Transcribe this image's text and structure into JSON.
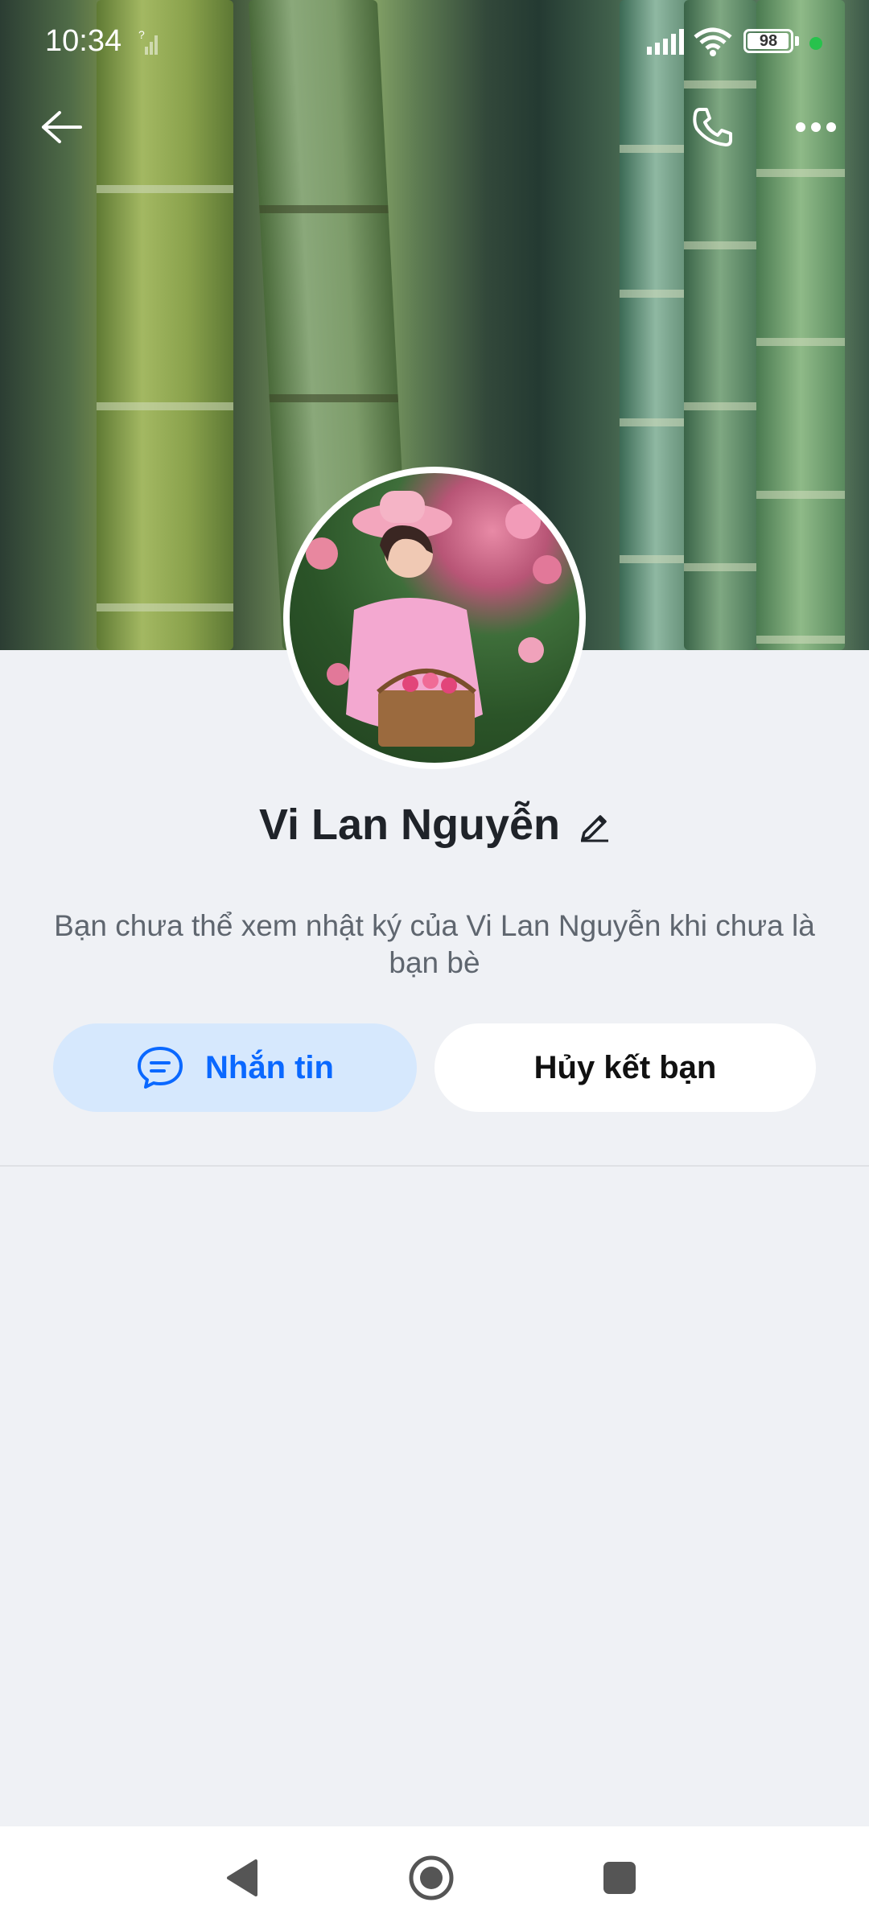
{
  "status_bar": {
    "time": "10:34",
    "battery_level": "98",
    "battery_fraction": 0.98,
    "notification_dot_color": "#27c24c",
    "icons": [
      "no-sim-icon",
      "cellular-signal-icon",
      "wifi-icon",
      "battery-icon"
    ]
  },
  "header": {
    "back_icon": "back-arrow-icon",
    "call_icon": "phone-icon",
    "more_icon": "more-options-icon"
  },
  "profile": {
    "name": "Vi Lan Nguyễn",
    "edit_icon": "pencil-icon",
    "notice": "Bạn chưa thể xem nhật ký của Vi Lan Nguyễn khi chưa là bạn bè"
  },
  "actions": {
    "message_label": "Nhắn tin",
    "message_icon": "chat-bubble-icon",
    "unfriend_label": "Hủy kết bạn"
  },
  "colors": {
    "accent": "#0a68ff",
    "message_button_bg": "#d6e8fd",
    "page_bg": "#eff1f5"
  },
  "nav_bar": {
    "icons": [
      "nav-back-icon",
      "nav-home-icon",
      "nav-recents-icon"
    ]
  }
}
